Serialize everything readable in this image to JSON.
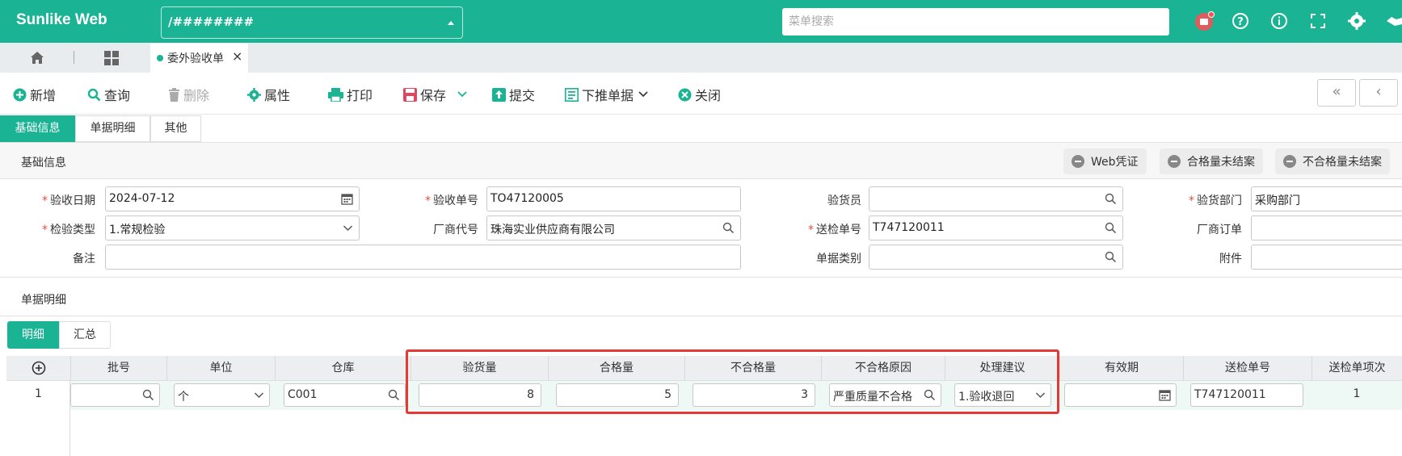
{
  "header": {
    "logo": "Sunlike Web",
    "path": "/########",
    "search_placeholder": "菜单搜索"
  },
  "tabstrip": {
    "doc_tab": "委外验收单",
    "close": "×"
  },
  "toolbar": {
    "new": "新增",
    "query": "查询",
    "delete": "删除",
    "properties": "属性",
    "print": "打印",
    "save": "保存",
    "submit": "提交",
    "push_down": "下推单据",
    "close": "关闭",
    "first": "«",
    "prev": "‹"
  },
  "section_tabs": [
    "基础信息",
    "单据明细",
    "其他"
  ],
  "basic": {
    "title": "基础信息",
    "flags": [
      "Web凭证",
      "合格量未结案",
      "不合格量未结案"
    ]
  },
  "form": {
    "receipt_date": {
      "label": "验收日期",
      "value": "2024-07-12"
    },
    "receipt_no": {
      "label": "验收单号",
      "value": "TO47120005"
    },
    "inspector": {
      "label": "验货员",
      "value": ""
    },
    "inspect_dept": {
      "label": "验货部门",
      "value": "采购部门"
    },
    "inspect_type": {
      "label": "检验类型",
      "value": "1.常规检验"
    },
    "vendor_code": {
      "label": "厂商代号",
      "value": "珠海实业供应商有限公司"
    },
    "send_no": {
      "label": "送检单号",
      "value": "T747120011"
    },
    "vendor_order": {
      "label": "厂商订单",
      "value": ""
    },
    "remark": {
      "label": "备注",
      "value": ""
    },
    "doc_category": {
      "label": "单据类别",
      "value": ""
    },
    "attachment": {
      "label": "附件",
      "value": ""
    }
  },
  "detail": {
    "title": "单据明细",
    "tabs": [
      "明细",
      "汇总"
    ],
    "columns": [
      "批号",
      "单位",
      "仓库",
      "验货量",
      "合格量",
      "不合格量",
      "不合格原因",
      "处理建议",
      "有效期",
      "送检单号",
      "送检单项次"
    ],
    "add_icon": "⊕",
    "rows": [
      {
        "no": "1",
        "batch": "",
        "unit": "个",
        "warehouse": "C001",
        "inspect_qty": "8",
        "pass_qty": "5",
        "fail_qty": "3",
        "fail_reason": "严重质量不合格",
        "suggestion": "1.验收退回",
        "expiry": "",
        "send_no": "T747120011",
        "send_item": "1"
      }
    ]
  },
  "colors": {
    "brand": "#1ab394",
    "highlight": "#e53935",
    "required": "#e74c3c"
  }
}
